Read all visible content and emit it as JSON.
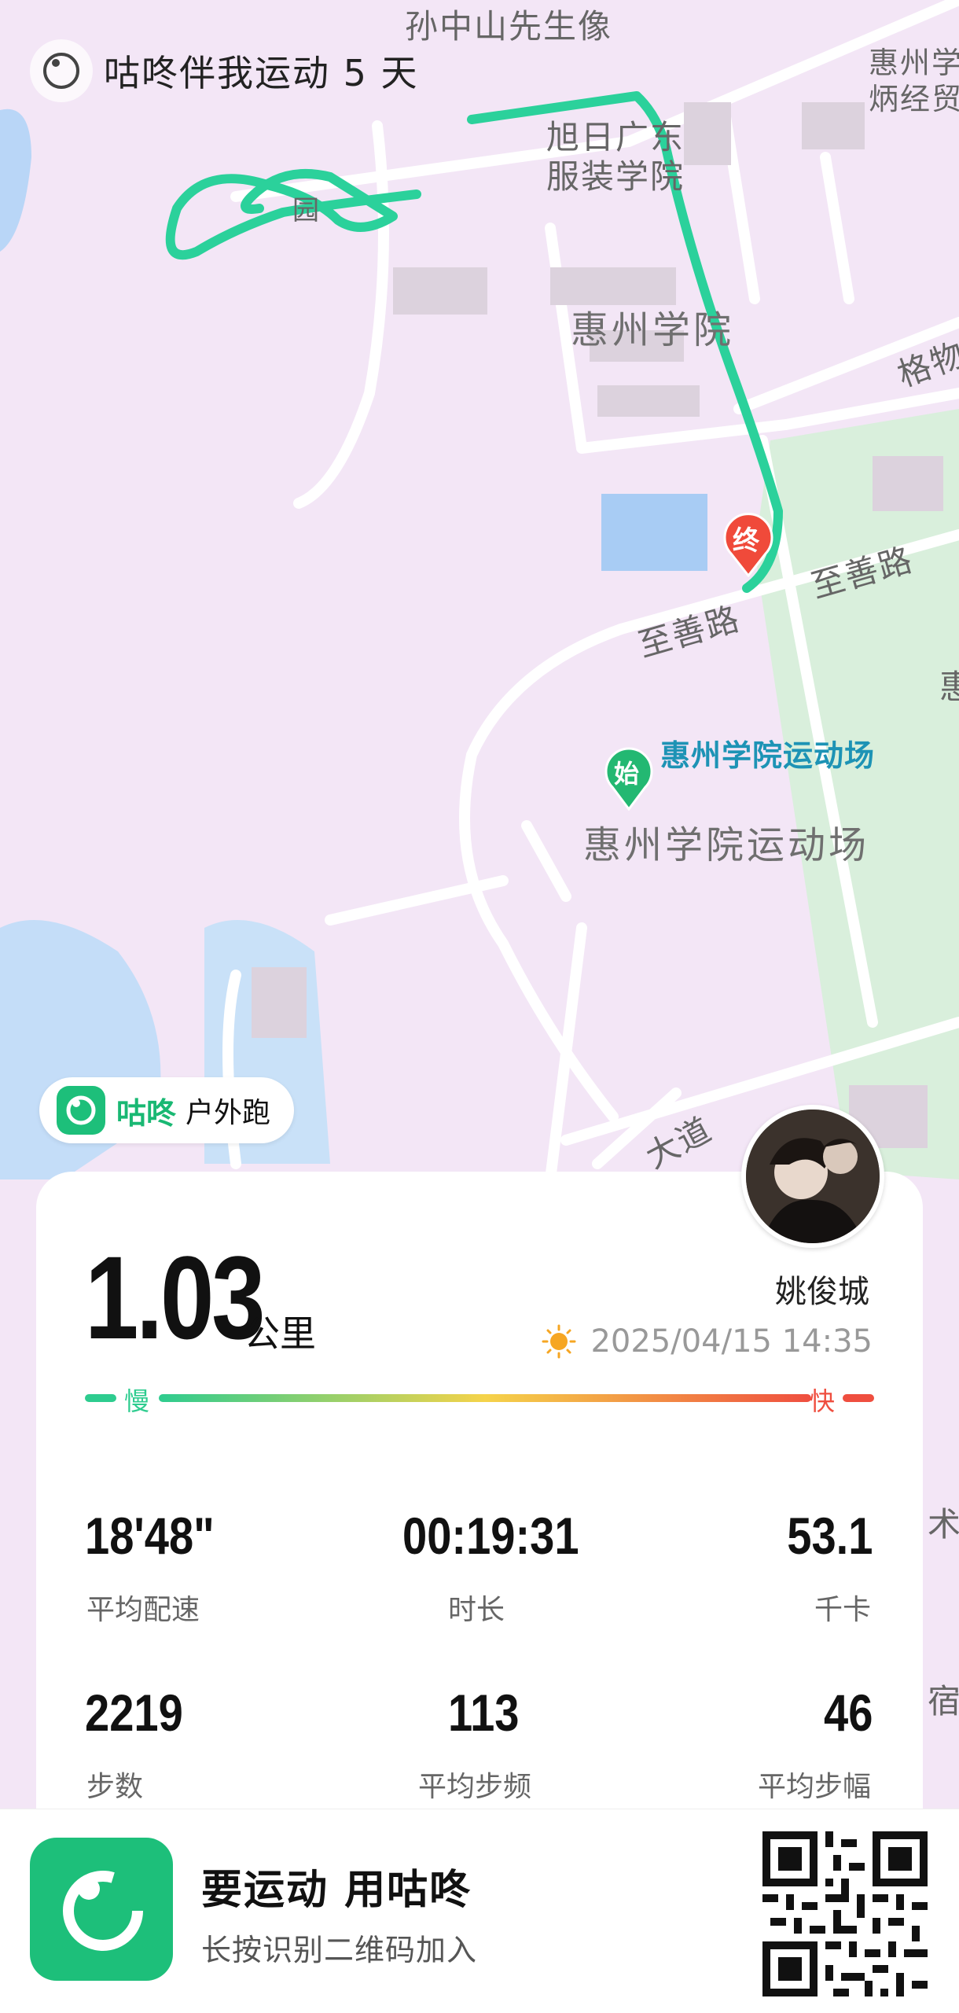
{
  "header": {
    "title": "咕咚伴我运动 5 天"
  },
  "map": {
    "labels": {
      "sun_yatsen_statue": "孙中山先生像",
      "xuri_fashion_school": "旭日广东\n服装学院",
      "huizhou_university": "惠州学院",
      "sports_field_blue": "惠州学院运动场",
      "sports_field_gray": "惠州学院运动场",
      "zhishan_road_1": "至善路",
      "zhishan_road_2": "至善路",
      "gewu": "格物",
      "huizhou_xue_edge": "惠州学\n炳经贸",
      "garden": "园",
      "avenue": "大道",
      "edge_hui": "惠",
      "edge_shu": "术",
      "edge_su": "宿"
    },
    "start_pin": "始",
    "end_pin": "终",
    "colors": {
      "route": "#2bd19b",
      "start": "#23b872",
      "end": "#f04a3a",
      "water": "#b9d6f7",
      "green": "#d9efdc"
    }
  },
  "brand_chip": {
    "name": "咕咚",
    "type": "户外跑"
  },
  "summary": {
    "distance": "1.03",
    "unit": "公里",
    "user": "姚俊城",
    "datetime": "2025/04/15 14:35",
    "weather_icon": "sun-icon",
    "pace_slow": "慢",
    "pace_fast": "快"
  },
  "stats": [
    {
      "value": "18'48\"",
      "label": "平均配速"
    },
    {
      "value": "00:19:31",
      "label": "时长"
    },
    {
      "value": "53.1",
      "label": "千卡"
    },
    {
      "value": "2219",
      "label": "步数"
    },
    {
      "value": "113",
      "label": "平均步频"
    },
    {
      "value": "46",
      "label": "平均步幅"
    }
  ],
  "footer": {
    "slogan": "要运动 用咕咚",
    "hint": "长按识别二维码加入"
  }
}
